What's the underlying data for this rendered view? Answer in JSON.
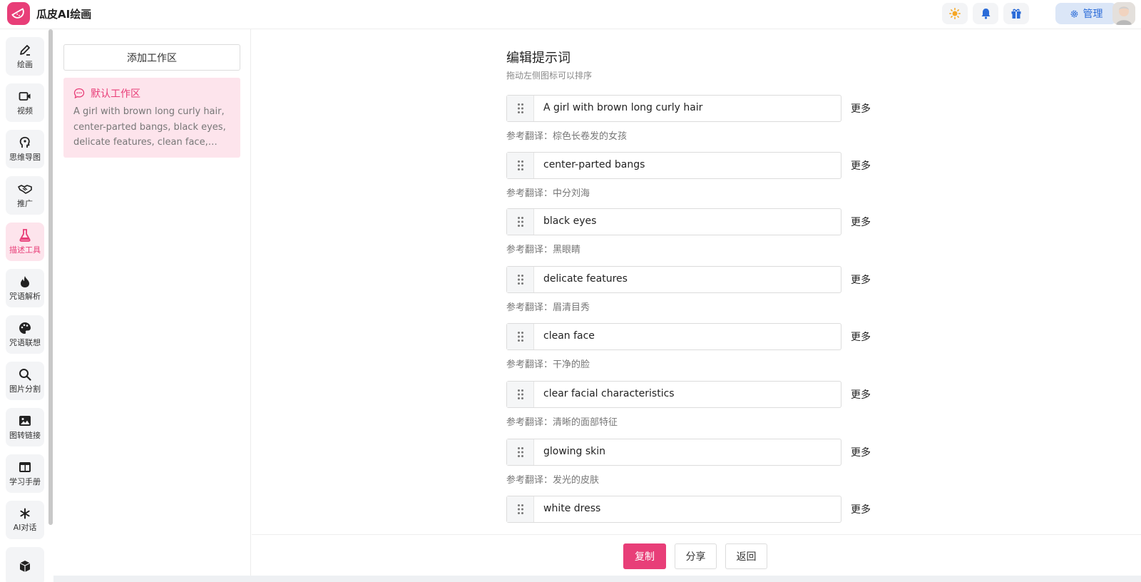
{
  "app": {
    "title": "瓜皮AI绘画"
  },
  "header": {
    "admin_label": "管理"
  },
  "colors": {
    "accent": "#e83e78",
    "accent_soft": "#fde4ec",
    "admin_blue": "#2a6bd8",
    "sun": "#f5a623",
    "bell": "#2a6bd8",
    "gift": "#2a6bd8"
  },
  "nav": {
    "items": [
      {
        "label": "绘画",
        "icon": "pen-icon"
      },
      {
        "label": "视频",
        "icon": "video-icon"
      },
      {
        "label": "思维导图",
        "icon": "brain-icon"
      },
      {
        "label": "推广",
        "icon": "handshake-icon"
      },
      {
        "label": "描述工具",
        "icon": "flask-icon",
        "active": true
      },
      {
        "label": "咒语解析",
        "icon": "fire-icon"
      },
      {
        "label": "咒语联想",
        "icon": "palette-icon"
      },
      {
        "label": "图片分割",
        "icon": "search-icon"
      },
      {
        "label": "图转链接",
        "icon": "image-icon"
      },
      {
        "label": "学习手册",
        "icon": "layout-icon"
      },
      {
        "label": "AI对话",
        "icon": "asterisk-icon"
      },
      {
        "label": "",
        "icon": "box-icon"
      }
    ]
  },
  "workspace": {
    "add_label": "添加工作区",
    "default_title": "默认工作区",
    "default_desc": "A girl with brown long curly hair, center-parted bangs, black eyes, delicate features, clean face, clear facial characteristics, glowing skin, white dress"
  },
  "editor": {
    "title": "编辑提示词",
    "subtitle": "拖动左侧图标可以排序",
    "more_label": "更多",
    "translation_prefix": "参考翻译：",
    "prompts": [
      {
        "text": "A girl with brown long curly hair",
        "translation": "参考翻译：棕色长卷发的女孩"
      },
      {
        "text": "center-parted bangs",
        "translation": "参考翻译：中分刘海"
      },
      {
        "text": "black eyes",
        "translation": "参考翻译：黑眼睛"
      },
      {
        "text": "delicate features",
        "translation": "参考翻译：眉清目秀"
      },
      {
        "text": "clean face",
        "translation": "参考翻译：干净的脸"
      },
      {
        "text": "clear facial characteristics",
        "translation": "参考翻译：清晰的面部特征"
      },
      {
        "text": "glowing skin",
        "translation": "参考翻译：发光的皮肤"
      },
      {
        "text": "white dress",
        "translation": ""
      }
    ]
  },
  "footer": {
    "copy_label": "复制",
    "share_label": "分享",
    "back_label": "返回"
  }
}
